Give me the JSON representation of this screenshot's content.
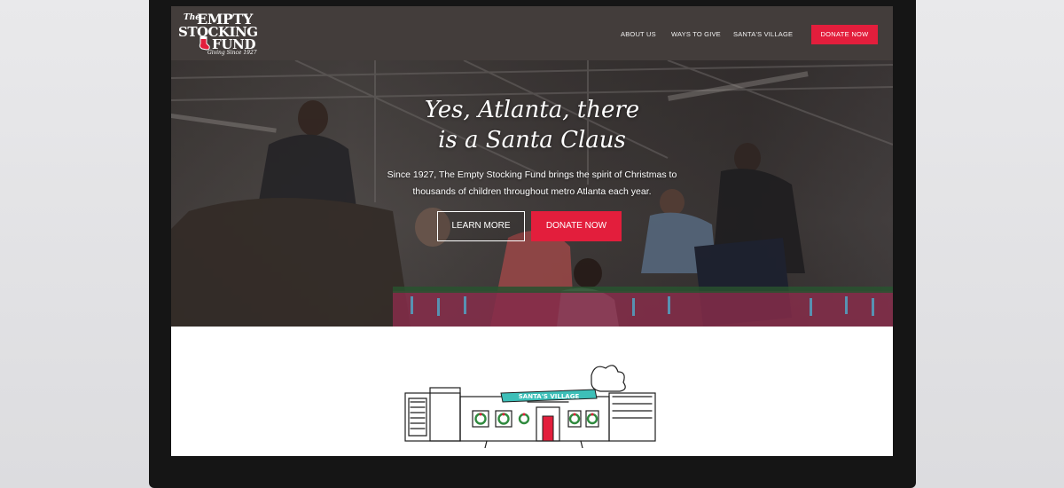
{
  "logo": {
    "the": "The",
    "empty": "EMPTY",
    "stocking": "STOCKING",
    "fund": "FUND",
    "tagline": "Giving Since 1927",
    "sock_icon": "stocking-icon"
  },
  "nav": {
    "items": [
      {
        "label": "ABOUT US"
      },
      {
        "label": "WAYS TO GIVE"
      },
      {
        "label": "SANTA'S VILLAGE"
      }
    ],
    "donate_label": "DONATE NOW"
  },
  "hero": {
    "title_line1": "Yes, Atlanta, there",
    "title_line2": "is a Santa Claus",
    "subtitle_line1": "Since 1927, The Empty Stocking Fund brings the spirit of Christmas to",
    "subtitle_line2": "thousands of children throughout metro Atlanta each year.",
    "learn_more_label": "LEARN MORE",
    "donate_label": "DONATE NOW"
  },
  "village": {
    "sign_text": "SANTA'S VILLAGE"
  },
  "colors": {
    "brand_red": "#e31e3c",
    "header_bg": "#433d3b",
    "sign_teal": "#3dbfb8"
  }
}
